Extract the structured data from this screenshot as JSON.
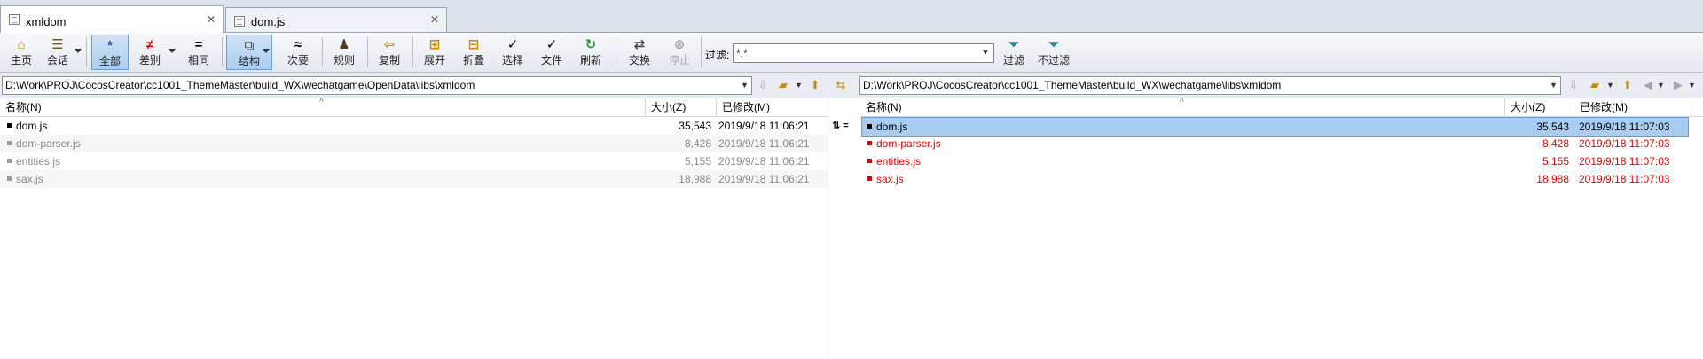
{
  "tabs": [
    {
      "label": "xmldom",
      "close": "✕",
      "active": true
    },
    {
      "label": "dom.js",
      "close": "✕",
      "active": false
    }
  ],
  "toolbar": {
    "home": {
      "icon": "⌂",
      "label": "主页"
    },
    "session": {
      "icon": "☰",
      "label": "会话"
    },
    "all": {
      "icon": "*",
      "label": "全部"
    },
    "diffs": {
      "icon": "≠",
      "label": "差别"
    },
    "same": {
      "icon": "=",
      "label": "相同"
    },
    "structure": {
      "icon": "⧉",
      "label": "结构"
    },
    "minor": {
      "icon": "≈",
      "label": "次要"
    },
    "rules": {
      "icon": "♟",
      "label": "规则"
    },
    "copy": {
      "icon": "⇦",
      "label": "复制"
    },
    "expand": {
      "icon": "⊞",
      "label": "展开"
    },
    "collapse": {
      "icon": "⊟",
      "label": "折叠"
    },
    "select": {
      "icon": "✓",
      "label": "选择"
    },
    "files": {
      "icon": "✓",
      "label": "文件"
    },
    "refresh": {
      "icon": "↻",
      "label": "刷新"
    },
    "swap": {
      "icon": "⇄",
      "label": "交换"
    },
    "stop": {
      "icon": "⊗",
      "label": "停止"
    },
    "filters": {
      "icon": "⏷",
      "label": "过滤"
    },
    "no_filters": {
      "icon": "⏷",
      "label": "不过滤"
    },
    "filter_label": "过滤:",
    "filter_value": "*.*"
  },
  "left": {
    "path": "D:\\Work\\PROJ\\CocosCreator\\cc1001_ThemeMaster\\build_WX\\wechatgame\\OpenData\\libs\\xmldom",
    "headers": {
      "name": "名称(N)",
      "size": "大小(Z)",
      "modified": "已修改(M)"
    },
    "rows": [
      {
        "name": "dom.js",
        "size": "35,543",
        "modified": "2019/9/18 11:06:21"
      },
      {
        "name": "dom-parser.js",
        "size": "8,428",
        "modified": "2019/9/18 11:06:21"
      },
      {
        "name": "entities.js",
        "size": "5,155",
        "modified": "2019/9/18 11:06:21"
      },
      {
        "name": "sax.js",
        "size": "18,988",
        "modified": "2019/9/18 11:06:21"
      }
    ]
  },
  "gutter": {
    "first_row_mark": "⇅ ="
  },
  "right": {
    "path": "D:\\Work\\PROJ\\CocosCreator\\cc1001_ThemeMaster\\build_WX\\wechatgame\\libs\\xmldom",
    "headers": {
      "name": "名称(N)",
      "size": "大小(Z)",
      "modified": "已修改(M)"
    },
    "rows": [
      {
        "name": "dom.js",
        "size": "35,543",
        "modified": "2019/9/18 11:07:03"
      },
      {
        "name": "dom-parser.js",
        "size": "8,428",
        "modified": "2019/9/18 11:07:03"
      },
      {
        "name": "entities.js",
        "size": "5,155",
        "modified": "2019/9/18 11:07:03"
      },
      {
        "name": "sax.js",
        "size": "18,988",
        "modified": "2019/9/18 11:07:03"
      }
    ]
  },
  "colors": {
    "diff_text": "#e00000",
    "selection": "#a9cdf0",
    "pressed": "#a9cdef"
  }
}
